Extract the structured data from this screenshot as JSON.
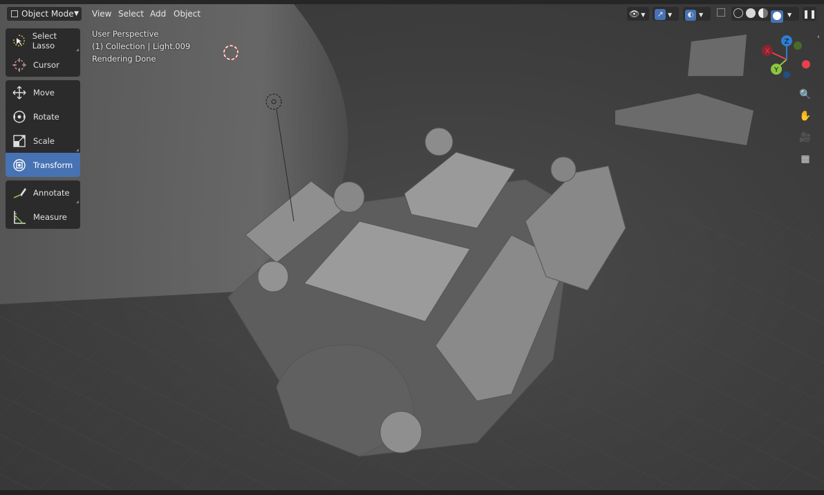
{
  "header": {
    "mode_label": "Object Mode",
    "menu": [
      "View",
      "Select",
      "Add",
      "Object"
    ]
  },
  "toolbar": {
    "groups": [
      [
        {
          "label": "Select Lasso",
          "icon": "lasso-select-icon"
        },
        {
          "label": "Cursor",
          "icon": "cursor-icon"
        }
      ],
      [
        {
          "label": "Move",
          "icon": "move-icon"
        },
        {
          "label": "Rotate",
          "icon": "rotate-icon"
        },
        {
          "label": "Scale",
          "icon": "scale-icon"
        },
        {
          "label": "Transform",
          "icon": "transform-icon",
          "active": true
        }
      ],
      [
        {
          "label": "Annotate",
          "icon": "annotate-icon"
        },
        {
          "label": "Measure",
          "icon": "measure-icon"
        }
      ]
    ]
  },
  "overlay": {
    "perspective": "User Perspective",
    "collection": "(1) Collection | Light.009",
    "status": "Rendering Done"
  },
  "gizmo": {
    "x": "X",
    "y": "Y",
    "z": "Z"
  },
  "colors": {
    "accent": "#4772b3",
    "x_axis": "#e8404f",
    "y_axis": "#8cc63f",
    "z_axis": "#2e7ed3"
  }
}
